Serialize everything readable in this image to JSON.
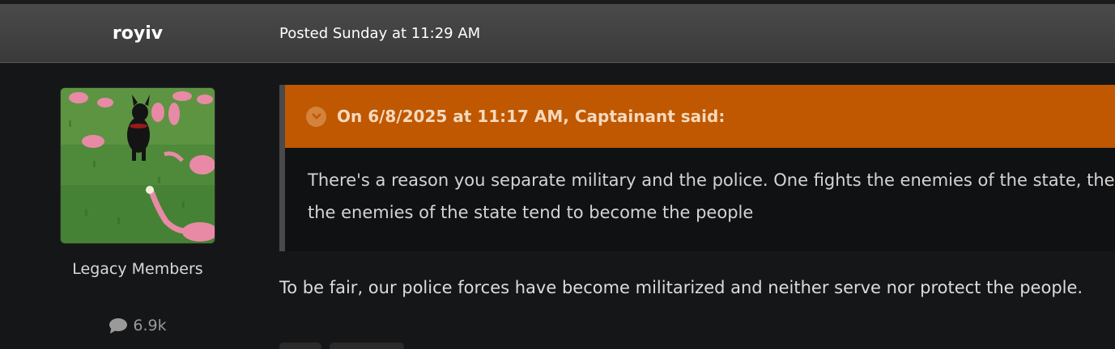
{
  "author": {
    "name": "royiv",
    "group": "Legacy Members",
    "post_count": "6.9k",
    "avatar_icon": "avatar-dog-flamingos-icon"
  },
  "post": {
    "date_label": "Posted Sunday at 11:29 AM",
    "quote": {
      "citation": "On 6/8/2025 at 11:17 AM, Captainant said:",
      "line1": "There's a reason you separate military and the police. One fights the enemies of the state, the",
      "line2": "the enemies of the state tend to become the people"
    },
    "body": "To be fair, our police forces have become militarized and neither serve nor protect the people."
  },
  "colors": {
    "quote_header": "#bf5800",
    "background": "#151617",
    "header": "#404040"
  }
}
